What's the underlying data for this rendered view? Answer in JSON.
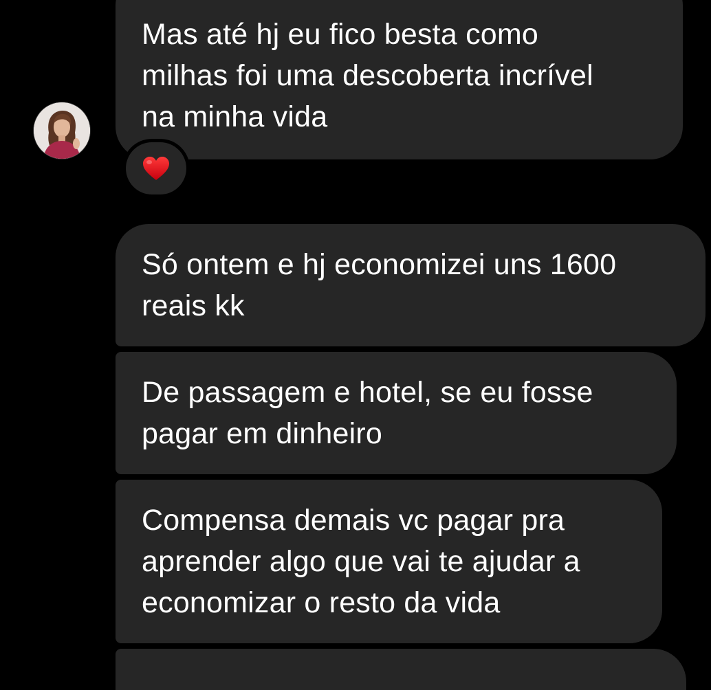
{
  "conversation": {
    "received_messages": [
      {
        "lines": [
          "Mas até hj eu fico besta como",
          "milhas foi uma descoberta incrível",
          "na minha vida"
        ]
      },
      {
        "lines": [
          "Só ontem e hj economizei uns 1600",
          "reais kk"
        ]
      },
      {
        "lines": [
          "De passagem e hotel, se eu fosse",
          "pagar em dinheiro"
        ]
      },
      {
        "lines": [
          "Compensa demais vc pagar pra",
          "aprender algo que vai te ajudar a",
          "economizar o resto da vida"
        ]
      }
    ],
    "reaction": {
      "emoji": "heart-icon",
      "color": "#e0141e"
    },
    "avatar": {
      "icon": "profile-photo"
    }
  },
  "theme": {
    "background": "#000000",
    "bubble": "#262626",
    "text": "#ffffff"
  }
}
